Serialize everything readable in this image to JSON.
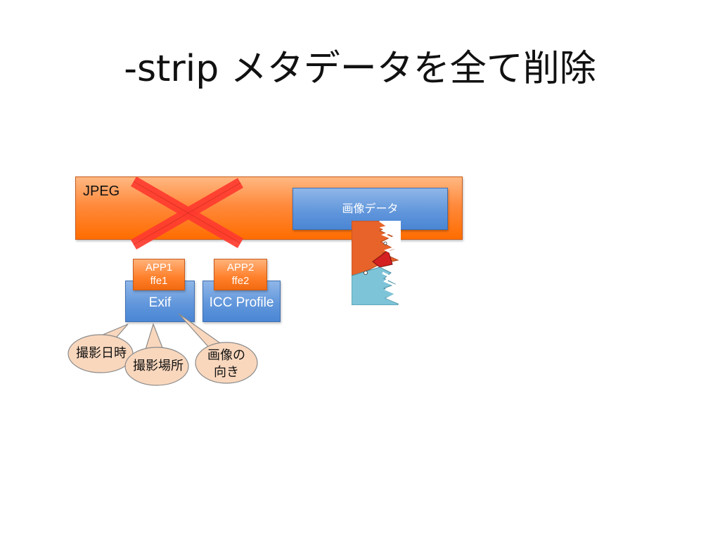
{
  "title": "-strip メタデータを全て削除",
  "jpeg": {
    "label": "JPEG"
  },
  "image_data": {
    "label": "画像データ"
  },
  "segments": [
    {
      "marker": "APP1",
      "code": "ffe1",
      "name": "Exif"
    },
    {
      "marker": "APP2",
      "code": "ffe2",
      "name": "ICC Profile"
    }
  ],
  "exif_fields": [
    {
      "line1": "撮影日時",
      "line2": ""
    },
    {
      "line1": "撮影場所",
      "line2": ""
    },
    {
      "line1": "画像の",
      "line2": "向き"
    }
  ],
  "colors": {
    "jpeg_orange": "#ff7f2a",
    "box_blue": "#5f95db",
    "cross_red": "#ff3b2f",
    "bubble_fill": "#f9d7bd",
    "jaw_orange": "#e8632a",
    "jaw_blue": "#7ec4d8"
  },
  "icons": {
    "cross": "delete-cross-icon",
    "jaw": "shark-jaw-icon"
  }
}
